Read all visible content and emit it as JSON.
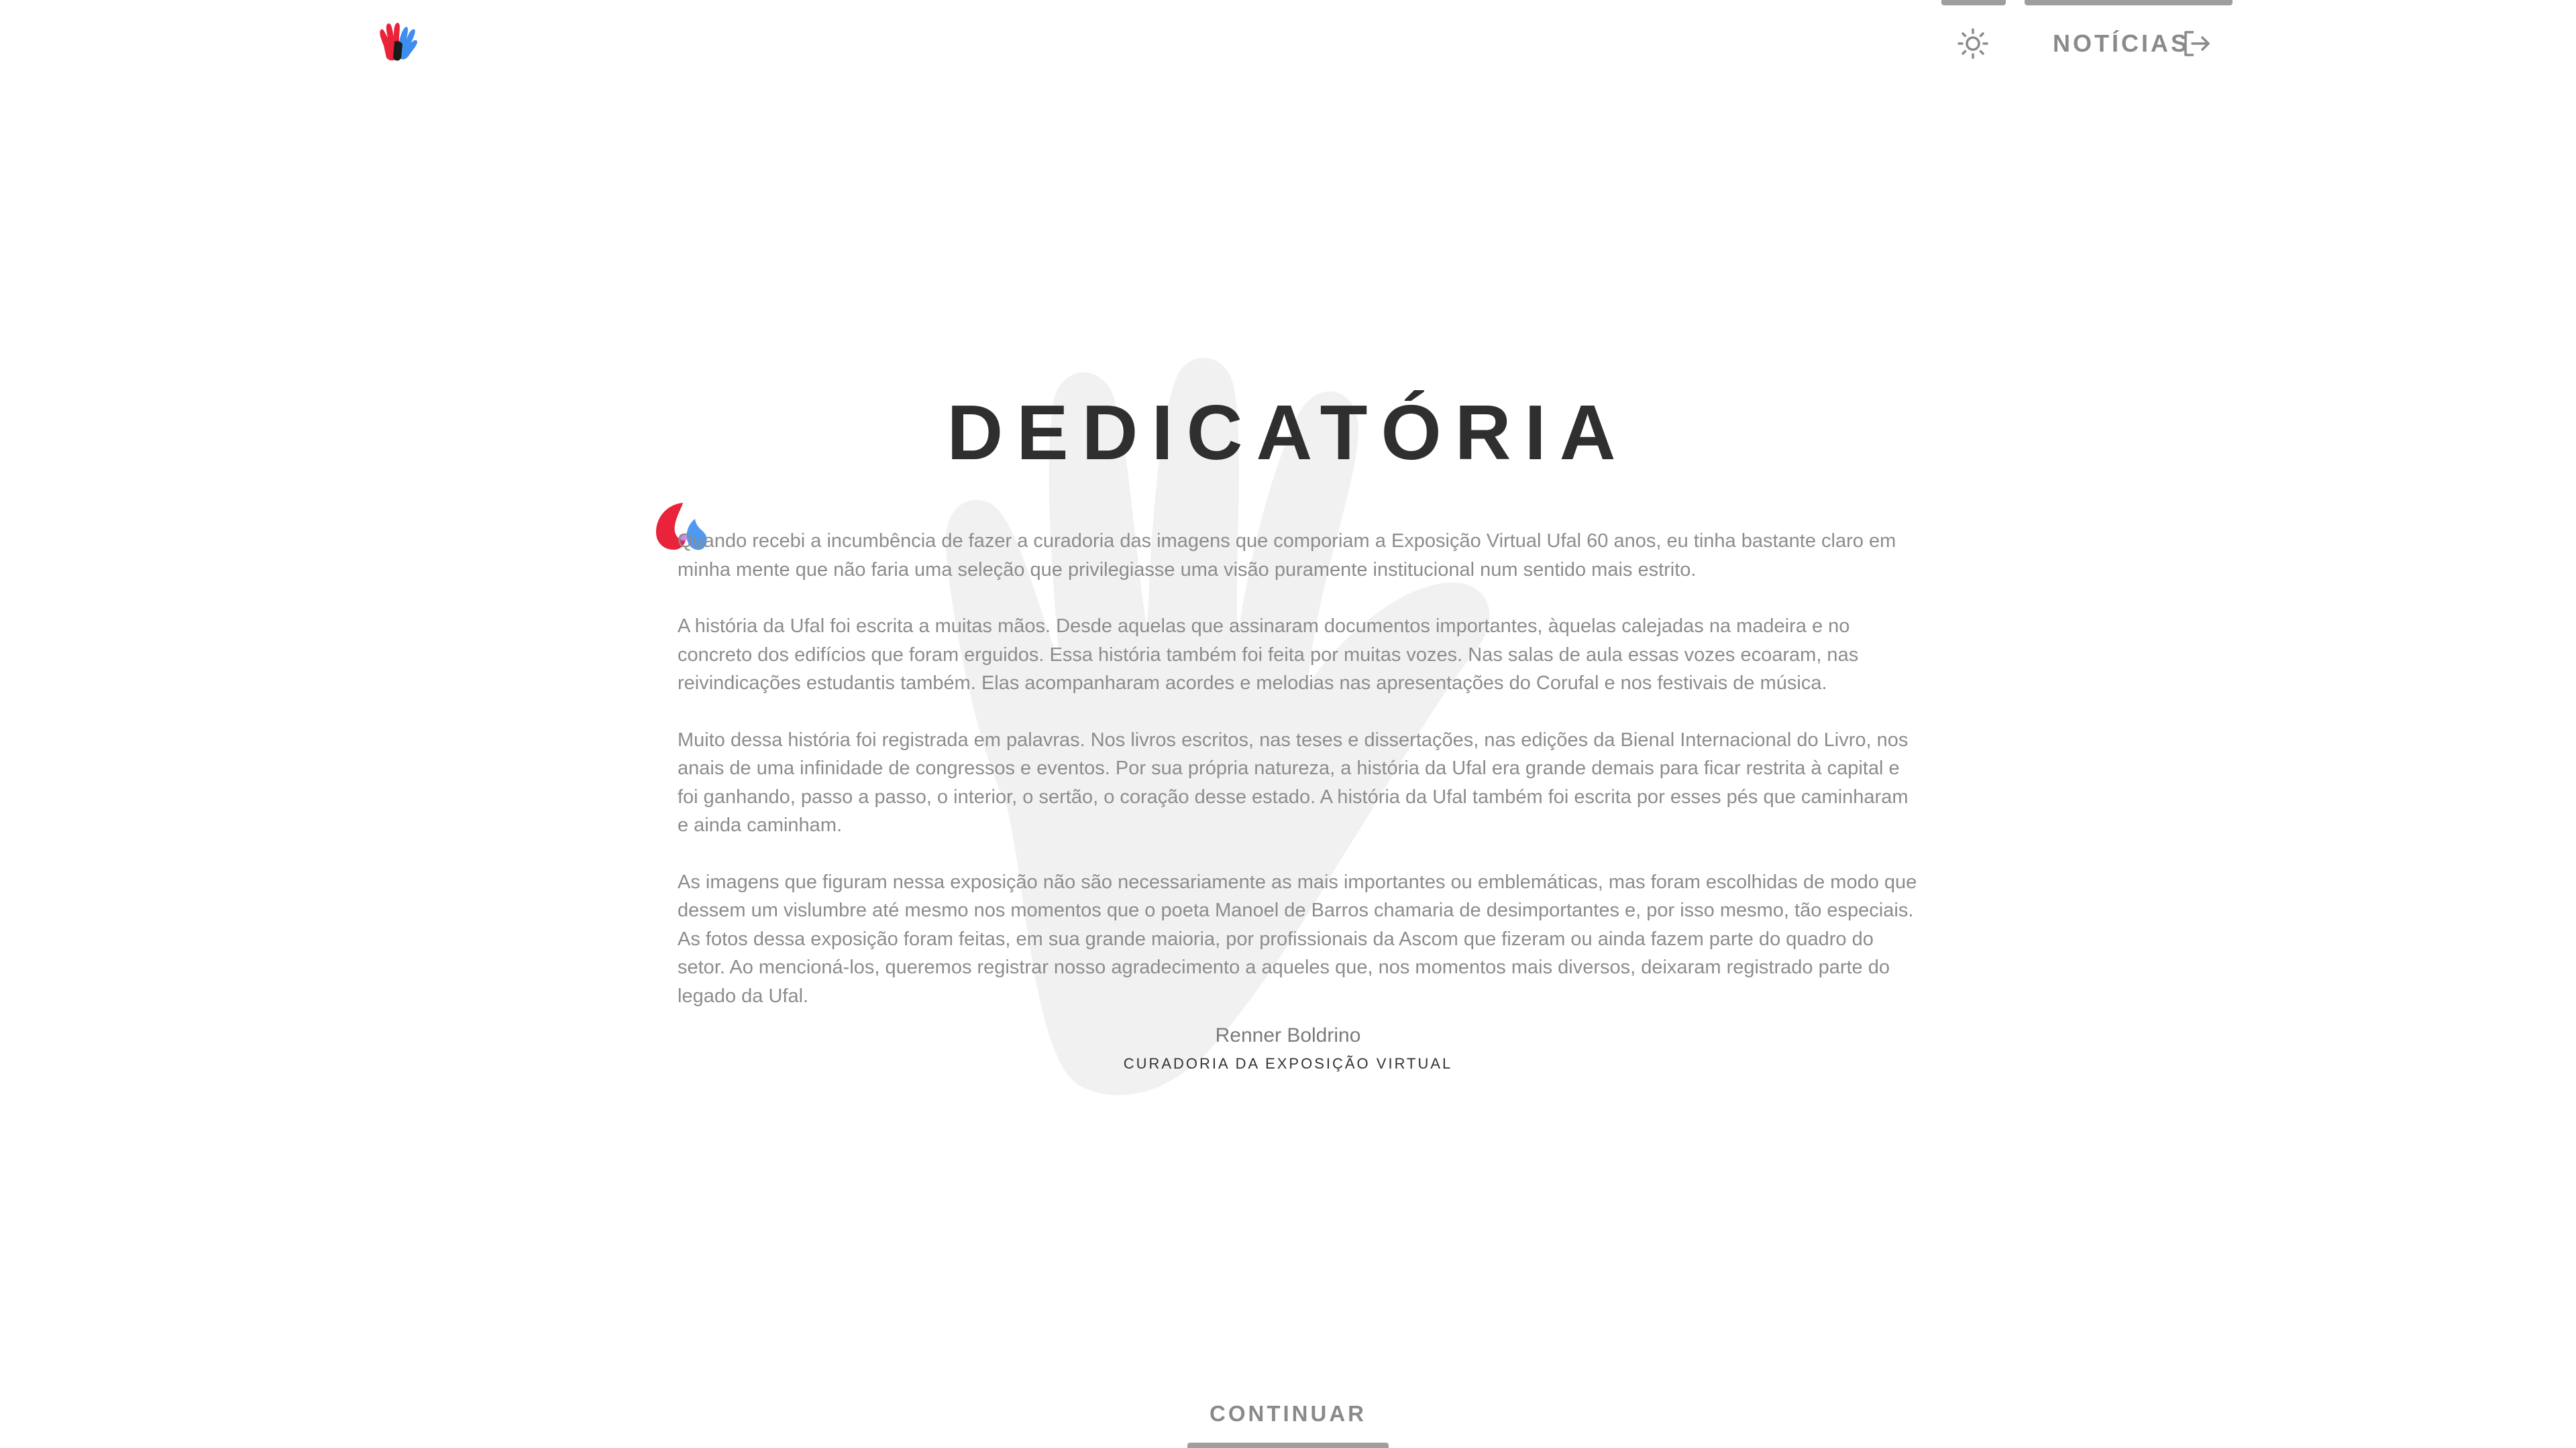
{
  "header": {
    "logo_icon": "ufal-hands-logo-icon",
    "theme_icon": "sun-icon",
    "news_label": "NOTÍCIAS",
    "news_icon": "logout-arrow-icon"
  },
  "main": {
    "title": "DEDICATÓRIA",
    "quote_icon": "quote-mark-icon",
    "paragraphs": [
      "Quando recebi a incumbência de fazer a curadoria das imagens que comporiam a Exposição Virtual Ufal 60 anos, eu tinha bastante claro em minha mente que não faria uma seleção que privilegiasse uma visão puramente institucional num sentido mais estrito.",
      "A história da Ufal foi escrita a muitas mãos. Desde aquelas que assinaram documentos importantes, àquelas calejadas na madeira e no concreto dos edifícios que foram erguidos.  Essa história também foi feita por muitas vozes. Nas salas de aula essas vozes ecoaram, nas reivindicações estudantis também. Elas acompanharam acordes e melodias nas apresentações do Corufal e nos festivais de música.",
      "Muito dessa história foi registrada em palavras. Nos livros escritos, nas teses e dissertações, nas edições da Bienal Internacional do Livro, nos anais de uma infinidade de congressos e eventos. Por sua própria natureza, a história da Ufal era grande demais para ficar restrita à capital e foi ganhando, passo a passo, o interior, o sertão, o coração desse estado. A história da Ufal também foi escrita por esses pés que caminharam e ainda caminham.",
      "As imagens que figuram nessa exposição não são necessariamente as mais importantes ou emblemáticas, mas foram escolhidas de modo que dessem um vislumbre até mesmo nos momentos que o poeta Manoel de Barros chamaria de desimportantes e, por isso mesmo, tão especiais. As fotos dessa exposição foram feitas, em sua grande maioria, por profissionais da Ascom que fizeram ou ainda fazem parte do quadro do setor. Ao mencioná-los, queremos registrar nosso agradecimento a aqueles que, nos momentos mais diversos, deixaram registrado parte do legado da Ufal."
    ],
    "author": "Renner Boldrino",
    "author_role": "CURADORIA DA EXPOSIÇÃO VIRTUAL",
    "background_icon": "hand-watermark-icon"
  },
  "footer": {
    "continue_label": "CONTINUAR"
  },
  "colors": {
    "text_dark": "#2f2f2f",
    "text_body": "#8c8c8c",
    "button_gray": "#8a8a8a",
    "accent_red": "#e8233a",
    "accent_blue": "#3d8ef0"
  }
}
